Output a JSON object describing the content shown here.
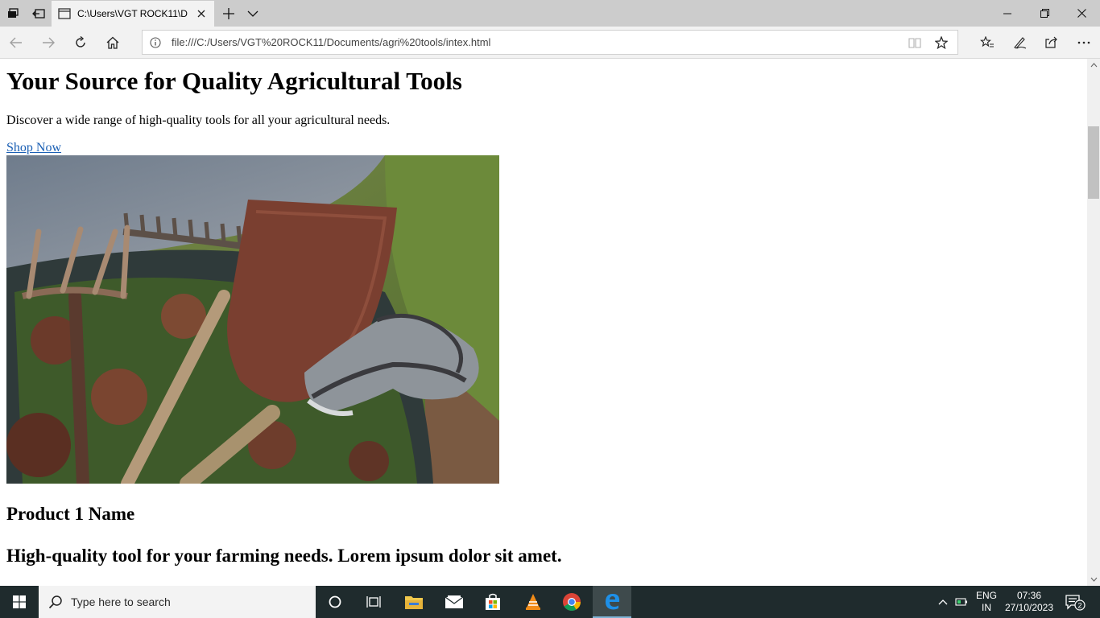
{
  "browser": {
    "tab": {
      "title": "C:\\Users\\VGT ROCK11\\D"
    },
    "address_bar": {
      "url": "file:///C:/Users/VGT%20ROCK11/Documents/agri%20tools/intex.html"
    }
  },
  "page": {
    "heading": "Your Source for Quality Agricultural Tools",
    "intro": "Discover a wide range of high-quality tools for all your agricultural needs.",
    "cta_link": "Shop Now",
    "hero_image": "photo of garden tools: rake, shovel, pitchfork and gloves on autumn leaves",
    "product_name": "Product 1 Name",
    "product_description": "High-quality tool for your farming needs. Lorem ipsum dolor sit amet."
  },
  "taskbar": {
    "search_placeholder": "Type here to search",
    "language": {
      "line1": "ENG",
      "line2": "IN"
    },
    "clock": {
      "time": "07:36",
      "date": "27/10/2023"
    },
    "notifications_count": "2"
  },
  "colors": {
    "link": "#1a5fb4",
    "tabstrip": "#cccccc",
    "taskbar": "#1f2b2d"
  }
}
